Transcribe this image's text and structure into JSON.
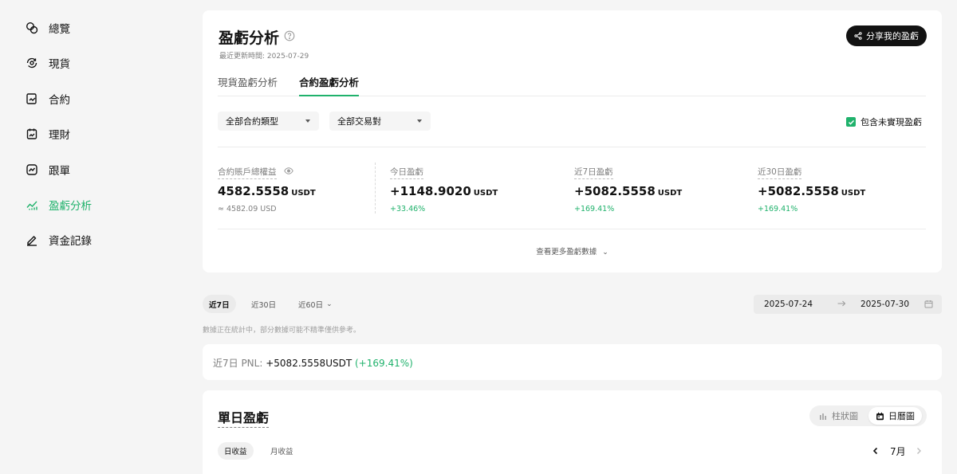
{
  "sidebar": {
    "items": [
      {
        "label": "總覽",
        "icon": "coins-icon"
      },
      {
        "label": "現貨",
        "icon": "spot-icon"
      },
      {
        "label": "合約",
        "icon": "contract-icon"
      },
      {
        "label": "理財",
        "icon": "earn-icon"
      },
      {
        "label": "跟單",
        "icon": "copy-trade-icon"
      },
      {
        "label": "盈虧分析",
        "icon": "chart-line-icon",
        "active": true
      },
      {
        "label": "資金記錄",
        "icon": "pen-icon"
      }
    ]
  },
  "header": {
    "title": "盈虧分析",
    "updated": "最近更新時間: 2025-07-29",
    "share_label": "分享我的盈虧"
  },
  "tabs": [
    {
      "label": "現貨盈虧分析",
      "active": false
    },
    {
      "label": "合約盈虧分析",
      "active": true
    }
  ],
  "filters": {
    "contract_type": "全部合約類型",
    "pair": "全部交易對",
    "include_unrealized": "包含未實現盈虧",
    "include_unrealized_checked": true
  },
  "stats": {
    "equity": {
      "label": "合約賬戶總權益",
      "value": "4582.5558",
      "unit": "USDT",
      "sub": "≈ 4582.09 USD"
    },
    "today": {
      "label": "今日盈虧",
      "value": "+1148.9020",
      "unit": "USDT",
      "sub": "+33.46%"
    },
    "d7": {
      "label": "近7日盈虧",
      "value": "+5082.5558",
      "unit": "USDT",
      "sub": "+169.41%"
    },
    "d30": {
      "label": "近30日盈虧",
      "value": "+5082.5558",
      "unit": "USDT",
      "sub": "+169.41%"
    }
  },
  "more_label": "查看更多盈虧數據",
  "range": {
    "options": [
      "近7日",
      "近30日",
      "近60日"
    ],
    "active": "近7日",
    "start": "2025-07-24",
    "end": "2025-07-30"
  },
  "notice": "數據正在統計中，部分數據可能不精準僅供參考。",
  "pnl": {
    "label": "近7日 PNL:",
    "value": "+5082.5558",
    "unit": "USDT",
    "pct": "(+169.41%)"
  },
  "daily": {
    "title": "單日盈虧",
    "views": {
      "bar": "柱狀圖",
      "calendar": "日曆圖",
      "active": "calendar"
    },
    "subtabs": {
      "daily": "日收益",
      "monthly": "月收益",
      "active": "daily"
    },
    "month": "7月"
  },
  "colors": {
    "accent": "#20b26c",
    "dark": "#121212"
  }
}
